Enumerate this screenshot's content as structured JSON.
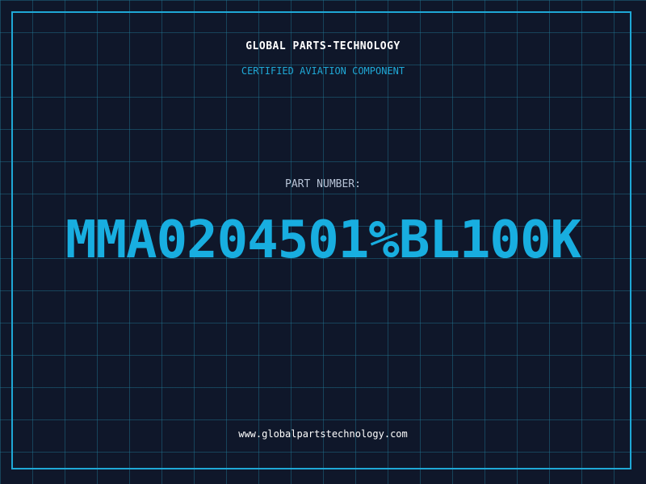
{
  "header": {
    "title": "GLOBAL PARTS-TECHNOLOGY",
    "subtitle": "CERTIFIED AVIATION COMPONENT"
  },
  "main": {
    "label": "PART NUMBER:",
    "part_number": "MMA0204501%BL100K"
  },
  "footer": {
    "url": "www.globalpartstechnology.com"
  },
  "colors": {
    "background": "#0f172a",
    "grid": "#227896",
    "accent": "#18aee0",
    "title": "#ffffff",
    "label": "#b7c3d6"
  }
}
